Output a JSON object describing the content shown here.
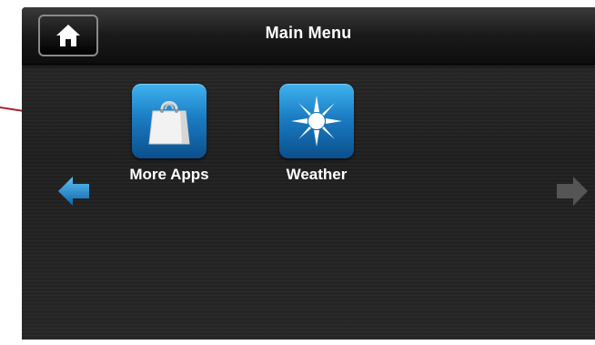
{
  "header": {
    "title": "Main Menu",
    "home_icon": "home-icon"
  },
  "apps": [
    {
      "label": "More Apps",
      "icon": "shopping-bag-icon"
    },
    {
      "label": "Weather",
      "icon": "sun-icon"
    }
  ],
  "navigation": {
    "prev_icon": "arrow-left-icon",
    "next_icon": "arrow-right-icon",
    "prev_enabled": true,
    "next_enabled": false
  },
  "colors": {
    "accent_blue": "#1b7dc4",
    "callout_red": "#a8232b",
    "disabled_arrow": "#555555"
  }
}
